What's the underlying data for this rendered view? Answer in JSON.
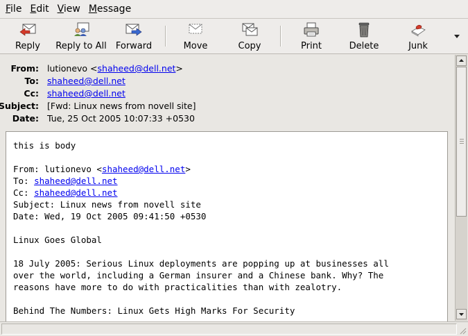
{
  "menubar": {
    "items": [
      "File",
      "Edit",
      "View",
      "Message"
    ]
  },
  "toolbar": {
    "buttons": {
      "reply": "Reply",
      "reply_all": "Reply to All",
      "forward": "Forward",
      "move": "Move",
      "copy": "Copy",
      "print": "Print",
      "delete": "Delete",
      "junk": "Junk"
    }
  },
  "headers": {
    "from_label": "From:",
    "from_name": "lutionevo <",
    "from_email": "shaheed@dell.net",
    "from_close": ">",
    "to_label": "To:",
    "to_email": "shaheed@dell.net",
    "cc_label": "Cc:",
    "cc_email": "shaheed@dell.net",
    "subject_label": "Subject:",
    "subject": "[Fwd: Linux news from novell site]",
    "date_label": "Date:",
    "date": "Tue, 25 Oct 2005 10:07:33 +0530"
  },
  "body": {
    "intro": "this is body",
    "fwd_from_prefix": "From: lutionevo <",
    "fwd_from_email": "shaheed@dell.net",
    "fwd_from_close": ">",
    "fwd_to_prefix": "To: ",
    "fwd_to_email": "shaheed@dell.net",
    "fwd_cc_prefix": "Cc: ",
    "fwd_cc_email": "shaheed@dell.net",
    "fwd_subject": "Subject: Linux news from novell site",
    "fwd_date": "Date: Wed, 19 Oct 2005 09:41:50 +0530",
    "heading": "Linux Goes Global",
    "para1_line1": "18 July 2005: Serious Linux deployments are popping up at businesses all",
    "para1_line2": "over the world, including a German insurer and a Chinese bank. Why? The",
    "para1_line3": "reasons have more to do with practicalities than with zealotry.",
    "para2": "Behind The Numbers: Linux Gets High Marks For Security"
  }
}
